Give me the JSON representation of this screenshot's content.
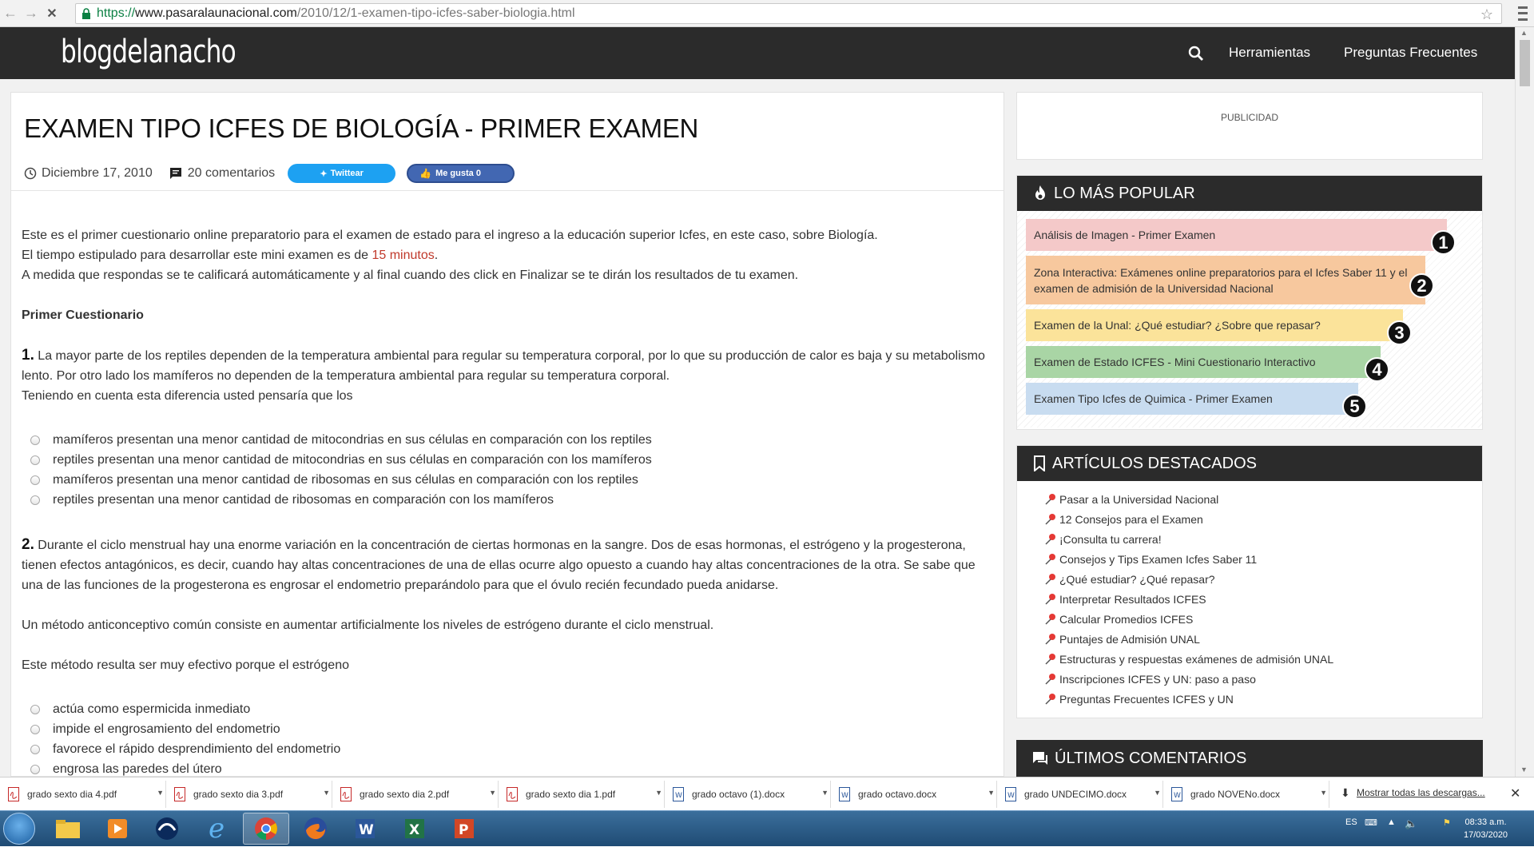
{
  "browser": {
    "url_scheme": "https://",
    "url_host": "www.pasaralaunacional.com",
    "url_path": "/2010/12/1-examen-tipo-icfes-saber-biologia.html"
  },
  "site": {
    "logo": "blogdelanacho",
    "nav": [
      "Herramientas",
      "Preguntas Frecuentes"
    ]
  },
  "article": {
    "title": "EXAMEN TIPO ICFES DE BIOLOGÍA - PRIMER EXAMEN",
    "date": "Diciembre 17, 2010",
    "comments": "20 comentarios",
    "tweet_label": "Twittear",
    "like_label": "Me gusta 0",
    "intro1": "Este es el primer cuestionario online preparatorio para el examen de estado para el ingreso a la educación superior Icfes, en este caso, sobre Biología.",
    "intro2_pre": "El tiempo estipulado para desarrollar este mini examen es de ",
    "intro2_time": "15 minutos",
    "intro2_post": ".",
    "intro3": "A medida que respondas se te calificará automáticamente y al final cuando des click en Finalizar se te dirán los resultados de tu examen.",
    "section": "Primer Cuestionario",
    "q1_num": "1.",
    "q1_text": " La mayor parte de los reptiles dependen de la temperatura ambiental para regular su temperatura corporal, por lo que su producción de calor es baja y su metabolismo lento. Por otro lado los mamíferos no dependen de la temperatura ambiental para regular su temperatura corporal.",
    "q1_text2": "Teniendo en cuenta esta diferencia usted pensaría que los",
    "q1_options": [
      "mamíferos presentan una menor cantidad de mitocondrias en sus células en comparación con los reptiles",
      "reptiles presentan una menor cantidad de mitocondrias en sus células en comparación con los mamíferos",
      "mamíferos presentan una menor cantidad de ribosomas en sus células en comparación con los reptiles",
      "reptiles presentan una menor cantidad de ribosomas en comparación con los mamíferos"
    ],
    "q2_num": "2.",
    "q2_text": " Durante el ciclo menstrual hay una enorme variación en la concentración de ciertas hormonas en la sangre. Dos de esas hormonas, el estrógeno y la progesterona, tienen efectos antagónicos, es decir, cuando hay altas concentraciones de una de ellas ocurre algo opuesto a cuando hay altas concentraciones de la otra. Se sabe que una de las funciones de la progesterona es engrosar el endometrio preparándolo para que el óvulo recién fecundado pueda anidarse.",
    "q2_text2": "Un método anticonceptivo común consiste en aumentar artificialmente los niveles de estrógeno durante el ciclo menstrual.",
    "q2_text3": "Este método resulta ser muy efectivo porque el estrógeno",
    "q2_options": [
      "actúa como espermicida inmediato",
      "impide el engrosamiento del endometrio",
      "favorece el rápido desprendimiento del endometrio",
      "engrosa las paredes del útero"
    ]
  },
  "sidebar": {
    "ad_label": "PUBLICIDAD",
    "popular_title": "LO MÁS POPULAR",
    "popular": [
      {
        "label": "Análisis de Imagen - Primer Examen",
        "rank": "1",
        "color": "#f4c9c9"
      },
      {
        "label": "Zona Interactiva: Exámenes online preparatorios para el Icfes Saber 11 y el examen de admisión de la Universidad Nacional",
        "rank": "2",
        "color": "#f7c89e"
      },
      {
        "label": "Examen de la Unal: ¿Qué estudiar? ¿Sobre que repasar?",
        "rank": "3",
        "color": "#fbe39a"
      },
      {
        "label": "Examen de Estado ICFES - Mini Cuestionario Interactivo",
        "rank": "4",
        "color": "#a9d5a5"
      },
      {
        "label": "Examen Tipo Icfes de Quimica - Primer Examen",
        "rank": "5",
        "color": "#c8dcf0"
      }
    ],
    "featured_title": "ARTÍCULOS DESTACADOS",
    "featured": [
      "Pasar a la Universidad Nacional",
      "12 Consejos para el Examen",
      "¡Consulta tu carrera!",
      "Consejos y Tips Examen Icfes Saber 11",
      "¿Qué estudiar? ¿Qué repasar?",
      "Interpretar Resultados ICFES",
      "Calcular Promedios ICFES",
      "Puntajes de Admisión UNAL",
      "Estructuras y respuestas exámenes de admisión UNAL",
      "Inscripciones ICFES y UN: paso a paso",
      "Preguntas Frecuentes ICFES y UN"
    ],
    "comments_title": "ÚLTIMOS COMENTARIOS"
  },
  "downloads": {
    "items": [
      {
        "name": "grado sexto dia 4.pdf",
        "type": "pdf"
      },
      {
        "name": "grado sexto dia 3.pdf",
        "type": "pdf"
      },
      {
        "name": "grado sexto dia 2.pdf",
        "type": "pdf"
      },
      {
        "name": "grado sexto dia 1.pdf",
        "type": "pdf"
      },
      {
        "name": "grado octavo (1).docx",
        "type": "docx"
      },
      {
        "name": "grado octavo.docx",
        "type": "docx"
      },
      {
        "name": "grado UNDECIMO.docx",
        "type": "docx"
      },
      {
        "name": "grado NOVENo.docx",
        "type": "docx"
      }
    ],
    "show_all": "Mostrar todas las descargas..."
  },
  "taskbar": {
    "lang": "ES",
    "time": "08:33 a.m.",
    "date": "17/03/2020"
  }
}
